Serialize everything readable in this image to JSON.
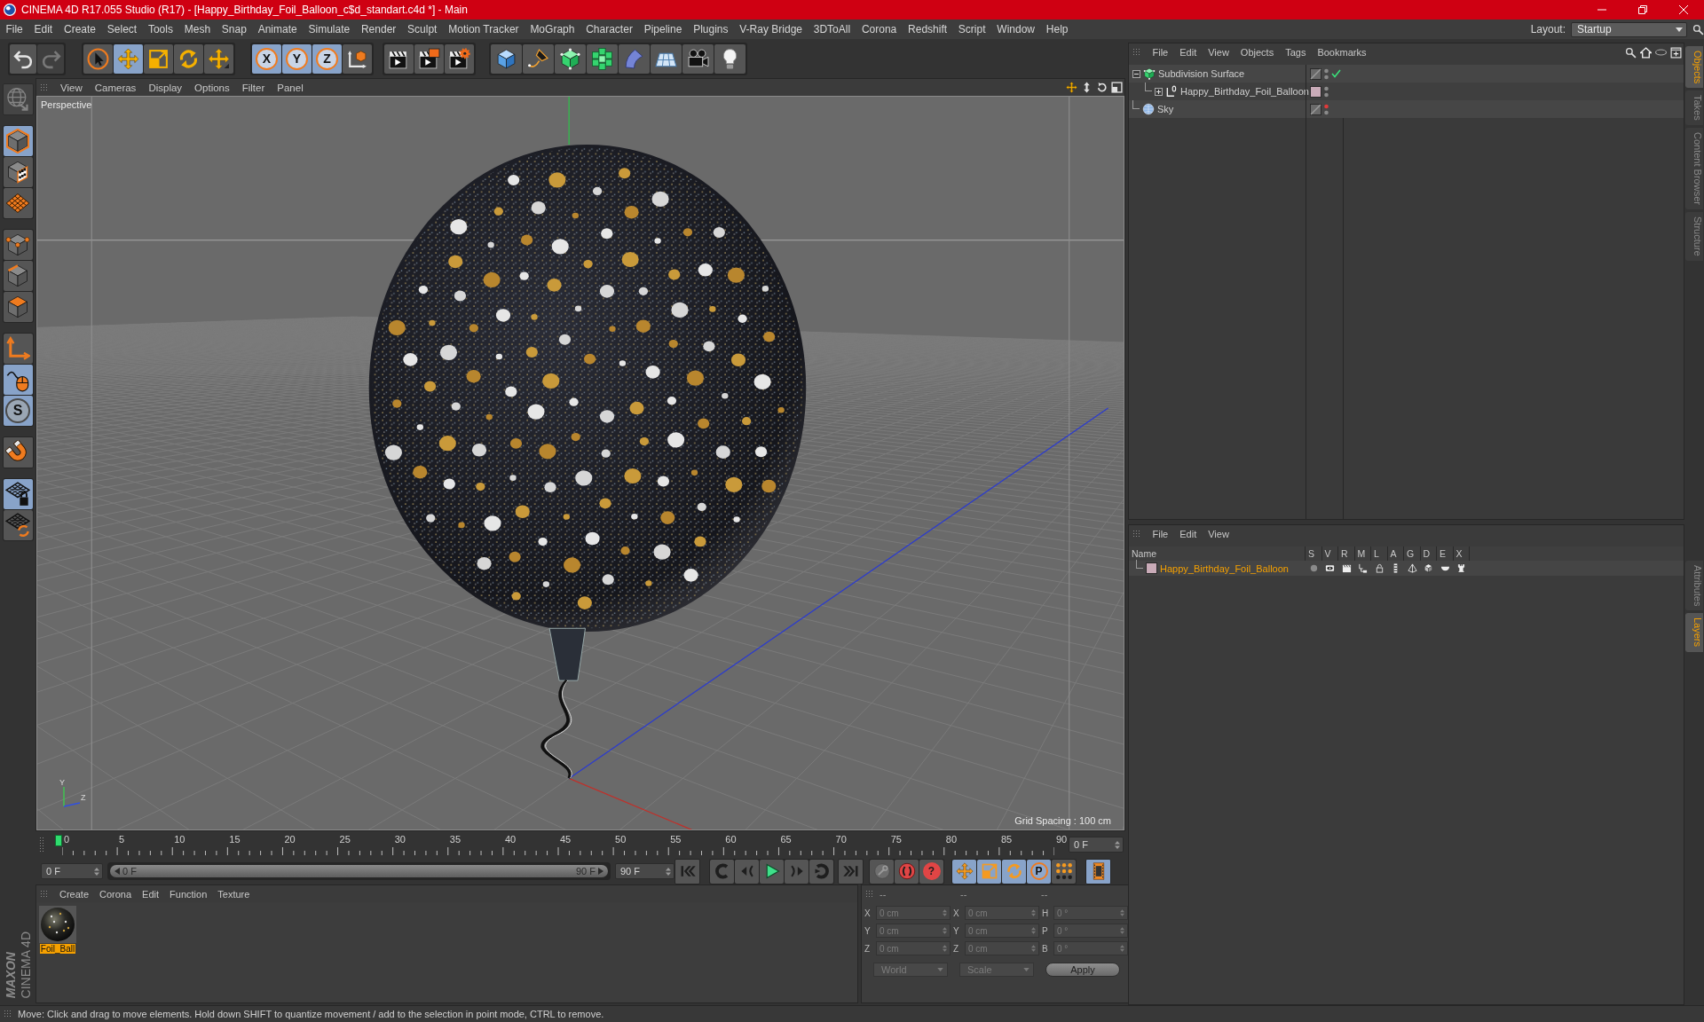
{
  "window": {
    "title": "CINEMA 4D R17.055 Studio (R17) - [Happy_Birthday_Foil_Balloon_c$d_standart.c4d *] - Main"
  },
  "menu_bar": [
    "File",
    "Edit",
    "Create",
    "Select",
    "Tools",
    "Mesh",
    "Snap",
    "Animate",
    "Simulate",
    "Render",
    "Sculpt",
    "Motion Tracker",
    "MoGraph",
    "Character",
    "Pipeline",
    "Plugins",
    "V-Ray Bridge",
    "3DToAll",
    "Corona",
    "Redshift",
    "Script",
    "Window",
    "Help"
  ],
  "layout": {
    "label": "Layout:",
    "value": "Startup"
  },
  "toolbar": [
    [
      {
        "kind": "undo",
        "selected": false,
        "disabled": false
      },
      {
        "kind": "redo",
        "selected": false,
        "disabled": true
      }
    ],
    [
      {
        "kind": "select",
        "selected": false,
        "disabled": false
      },
      {
        "kind": "move",
        "selected": true,
        "disabled": false
      },
      {
        "kind": "scale",
        "selected": false,
        "disabled": false
      },
      {
        "kind": "rotate",
        "selected": false,
        "disabled": false
      },
      {
        "kind": "recent",
        "selected": false,
        "disabled": false
      }
    ],
    [
      {
        "kind": "axis",
        "label": "X",
        "selected": true,
        "disabled": false
      },
      {
        "kind": "axis",
        "label": "Y",
        "selected": true,
        "disabled": false
      },
      {
        "kind": "axis",
        "label": "Z",
        "selected": true,
        "disabled": false
      },
      {
        "kind": "coordinates",
        "selected": false,
        "disabled": false
      }
    ],
    [
      {
        "kind": "render-view",
        "selected": false,
        "disabled": false
      },
      {
        "kind": "render-picture",
        "selected": false,
        "disabled": false
      },
      {
        "kind": "render-settings",
        "selected": false,
        "disabled": false
      }
    ],
    [
      {
        "kind": "cube",
        "selected": false,
        "disabled": false
      },
      {
        "kind": "pen",
        "selected": false,
        "disabled": false
      },
      {
        "kind": "subdivision",
        "selected": false,
        "disabled": false
      },
      {
        "kind": "cloner",
        "selected": false,
        "disabled": false
      },
      {
        "kind": "bend",
        "selected": false,
        "disabled": false
      },
      {
        "kind": "floor",
        "selected": false,
        "disabled": false
      },
      {
        "kind": "camera",
        "selected": false,
        "disabled": false
      },
      {
        "kind": "light",
        "selected": false,
        "disabled": false
      }
    ]
  ],
  "left_toolbar": [
    [
      {
        "kind": "make-editable",
        "selected": false,
        "disabled": true
      }
    ],
    [
      {
        "kind": "model",
        "selected": true,
        "disabled": false
      },
      {
        "kind": "texture",
        "selected": false,
        "disabled": false
      },
      {
        "kind": "workplane",
        "selected": false,
        "disabled": false
      }
    ],
    [
      {
        "kind": "points",
        "selected": false,
        "disabled": false
      },
      {
        "kind": "edges",
        "selected": false,
        "disabled": false
      },
      {
        "kind": "polygons",
        "selected": false,
        "disabled": false
      }
    ],
    [
      {
        "kind": "axis-mode",
        "selected": false,
        "disabled": false
      },
      {
        "kind": "tweak",
        "selected": true,
        "disabled": false
      },
      {
        "kind": "solo",
        "label": "S",
        "selected": true,
        "disabled": false
      }
    ],
    [
      {
        "kind": "magnet",
        "selected": false,
        "disabled": false
      }
    ],
    [
      {
        "kind": "snap",
        "selected": true,
        "disabled": false
      },
      {
        "kind": "workplane-lock",
        "selected": false,
        "disabled": false
      }
    ]
  ],
  "viewport": {
    "menu": [
      "View",
      "Cameras",
      "Display",
      "Options",
      "Filter",
      "Panel"
    ],
    "camera": "Perspective",
    "grid_spacing": "Grid Spacing : 100 cm",
    "axis_labels": [
      "Y",
      "Z"
    ]
  },
  "timeline": {
    "ticks": [
      "0",
      "5",
      "10",
      "15",
      "20",
      "25",
      "30",
      "35",
      "40",
      "45",
      "50",
      "55",
      "60",
      "65",
      "70",
      "75",
      "80",
      "85",
      "90"
    ],
    "playhead": {
      "level": 0
    },
    "current_frame": "0 F"
  },
  "transport": {
    "start_frame": "0 F",
    "range": {
      "start": "0 F",
      "end": "90 F",
      "level": 1
    },
    "end_frame": "90 F",
    "buttons": [
      [
        {
          "kind": "go-start",
          "selected": false
        }
      ],
      [
        {
          "kind": "prev-key",
          "selected": false
        },
        {
          "kind": "step-back",
          "selected": false
        },
        {
          "kind": "play",
          "selected": false
        },
        {
          "kind": "step-forward",
          "selected": false
        },
        {
          "kind": "next-key",
          "selected": false
        }
      ],
      [
        {
          "kind": "go-end",
          "selected": false
        }
      ],
      [
        {
          "kind": "record",
          "selected": false
        },
        {
          "kind": "autokey",
          "selected": false
        },
        {
          "kind": "keysel",
          "label": "?",
          "selected": false
        }
      ],
      [
        {
          "kind": "key-move",
          "selected": true
        },
        {
          "kind": "key-scale",
          "selected": true
        },
        {
          "kind": "key-rotate",
          "selected": true
        },
        {
          "kind": "key-param",
          "label": "P",
          "selected": true
        },
        {
          "kind": "key-points",
          "selected": false
        }
      ],
      [
        {
          "kind": "timeline",
          "selected": true
        }
      ]
    ]
  },
  "materials": {
    "menu": [
      "Create",
      "Corona",
      "Edit",
      "Function",
      "Texture"
    ],
    "items": [
      {
        "name": "Foil_Ball",
        "selected": true
      }
    ]
  },
  "coordinates": {
    "headers": [
      "--",
      "--",
      "--"
    ],
    "rows": [
      {
        "p_axis": "X",
        "position": "0 cm",
        "s_axis": "X",
        "size": "0 cm",
        "r_axis": "H",
        "rotation": "0 °"
      },
      {
        "p_axis": "Y",
        "position": "0 cm",
        "s_axis": "Y",
        "size": "0 cm",
        "r_axis": "P",
        "rotation": "0 °"
      },
      {
        "p_axis": "Z",
        "position": "0 cm",
        "s_axis": "Z",
        "size": "0 cm",
        "r_axis": "B",
        "rotation": "0 °"
      }
    ],
    "mode": "World",
    "size_mode": "Scale",
    "apply": "Apply"
  },
  "object_manager": {
    "menu": [
      "File",
      "Edit",
      "View",
      "Objects",
      "Tags",
      "Bookmarks"
    ],
    "objects": [
      {
        "name": "Subdivision Surface",
        "kind": "subdivision",
        "expanded": true,
        "enabled": true,
        "editor_hidden": false,
        "children": [
          {
            "name": "Happy_Birthday_Foil_Balloon",
            "kind": "null",
            "expanded": false,
            "enabled": false,
            "editor_hidden": false,
            "color": "#c9abb8"
          }
        ]
      },
      {
        "name": "Sky",
        "kind": "sky",
        "enabled": false,
        "editor_hidden": true
      }
    ]
  },
  "layer_manager": {
    "menu": [
      "File",
      "Edit",
      "View"
    ],
    "columns": [
      "Name",
      "S",
      "V",
      "R",
      "M",
      "L",
      "A",
      "G",
      "D",
      "E",
      "X"
    ],
    "layers": [
      {
        "name": "Happy_Birthday_Foil_Balloon",
        "color": "#c9abb8",
        "selected": true
      }
    ]
  },
  "side_tabs": {
    "top": [
      {
        "label": "Objects",
        "selected": true
      },
      {
        "label": "Takes",
        "selected": false
      },
      {
        "label": "Content Browser",
        "selected": false
      },
      {
        "label": "Structure",
        "selected": false
      }
    ],
    "bottom": [
      {
        "label": "Attributes",
        "selected": false
      },
      {
        "label": "Layers",
        "selected": true
      }
    ]
  },
  "logo": {
    "brand": "MAXON",
    "product": "CINEMA 4D"
  },
  "status_bar": "Move: Click and drag to move elements. Hold down SHIFT to quantize movement / add to the selection in point mode, CTRL to remove."
}
